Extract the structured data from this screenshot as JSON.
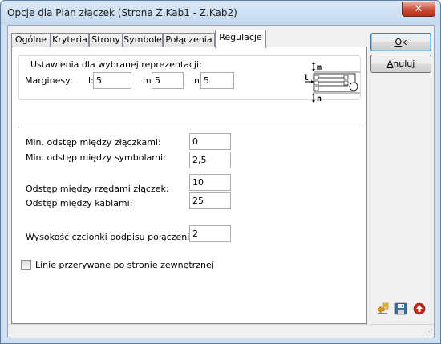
{
  "window": {
    "title": "Opcje dla Plan złączek  (Strona Z.Kab1 - Z.Kab2)",
    "close_glyph": "✕"
  },
  "tabs": [
    {
      "label": "Ogólne",
      "active": false
    },
    {
      "label": "Kryteria",
      "active": false
    },
    {
      "label": "Strony",
      "active": false
    },
    {
      "label": "Symbole",
      "active": false
    },
    {
      "label": "Połączenia",
      "active": false
    },
    {
      "label": "Regulacje",
      "active": true
    }
  ],
  "representation": {
    "group_label": "Ustawienia dla wybranej reprezentacji:",
    "margins_label": "Marginesy:",
    "l_label": "l:",
    "l_value": "5",
    "m_label": "m:",
    "m_value": "5",
    "n_label": "n:",
    "n_value": "5",
    "diagram": {
      "m": "m",
      "l": "l",
      "n": "n"
    }
  },
  "settings": {
    "min_terminal_gap_label": "Min. odstęp między złączkami:",
    "min_terminal_gap_value": "0",
    "min_symbol_gap_label": "Min. odstęp między symbolami:",
    "min_symbol_gap_value": "2,5",
    "row_gap_label": "Odstęp między rzędami złączek:",
    "row_gap_value": "10",
    "cable_gap_label": "Odstęp między kablami:",
    "cable_gap_value": "25",
    "font_height_label": "Wysokość czcionki podpisu połączenia:",
    "font_height_value": "2",
    "dashed_lines_label": "Linie przerywane po stronie zewnętrznej",
    "dashed_lines_checked": false
  },
  "buttons": {
    "ok_accel": "O",
    "ok_rest": "k",
    "cancel_accel": "A",
    "cancel_rest": "nuluj"
  },
  "icons": [
    "import-config-icon",
    "save-icon",
    "upload-icon"
  ],
  "colors": {
    "title_bar": "#c4d9f0",
    "close_button": "#c74a37",
    "default_button_border": "#3c7fb1"
  }
}
